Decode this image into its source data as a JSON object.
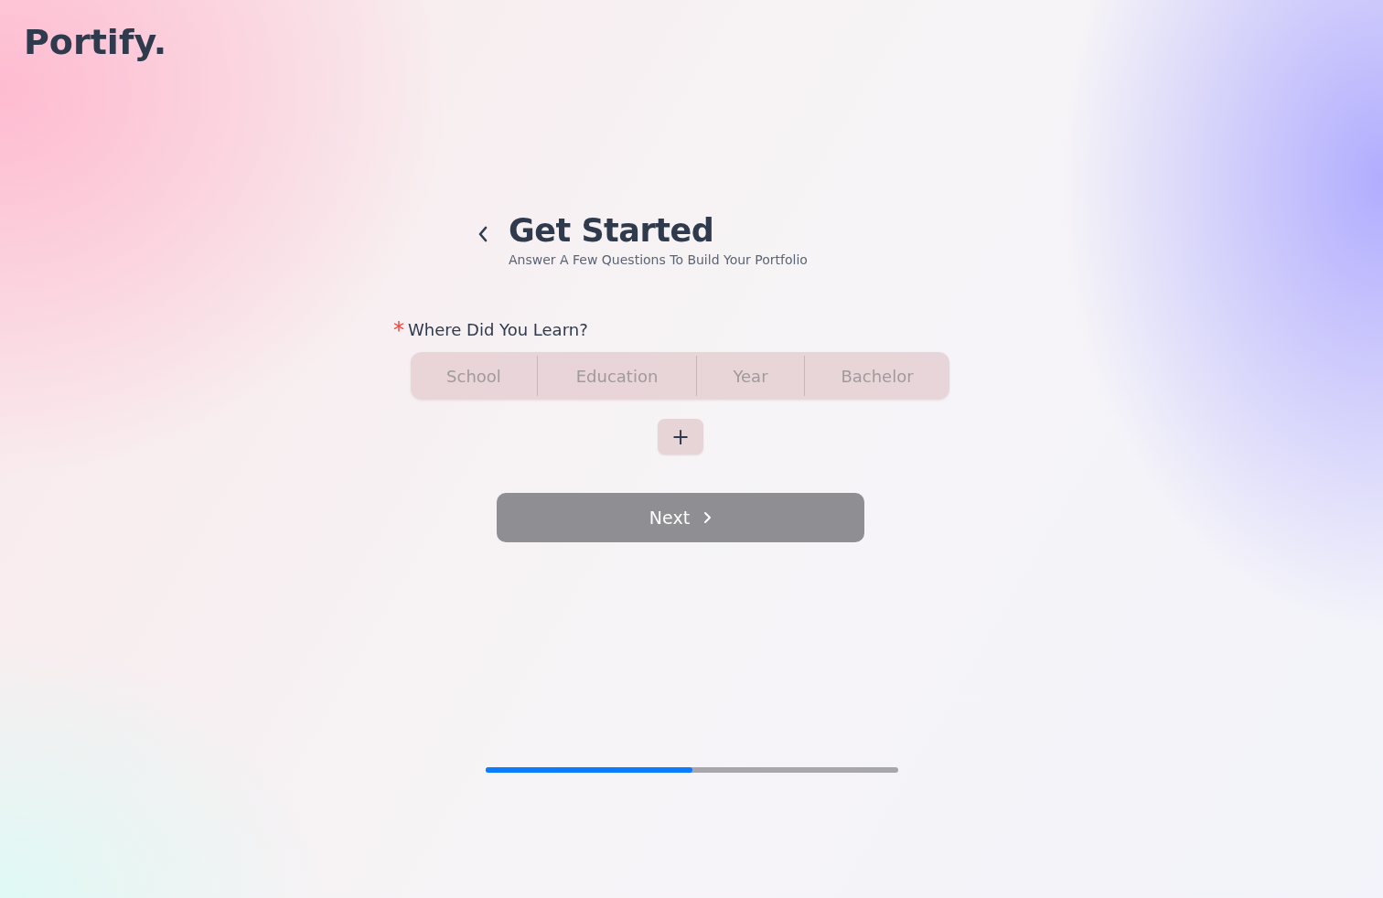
{
  "logo": "Portify.",
  "header": {
    "title": "Get Started",
    "subtitle": "Answer A Few Questions To Build Your Portfolio"
  },
  "question": {
    "required_mark": "*",
    "label": "Where Did You Learn?",
    "fields": [
      {
        "placeholder": "School"
      },
      {
        "placeholder": "Education"
      },
      {
        "placeholder": "Year"
      },
      {
        "placeholder": "Bachelor"
      }
    ],
    "add_button": "+"
  },
  "next_button": {
    "label": "Next",
    "disabled": true
  },
  "progress": {
    "level": 0.5
  }
}
